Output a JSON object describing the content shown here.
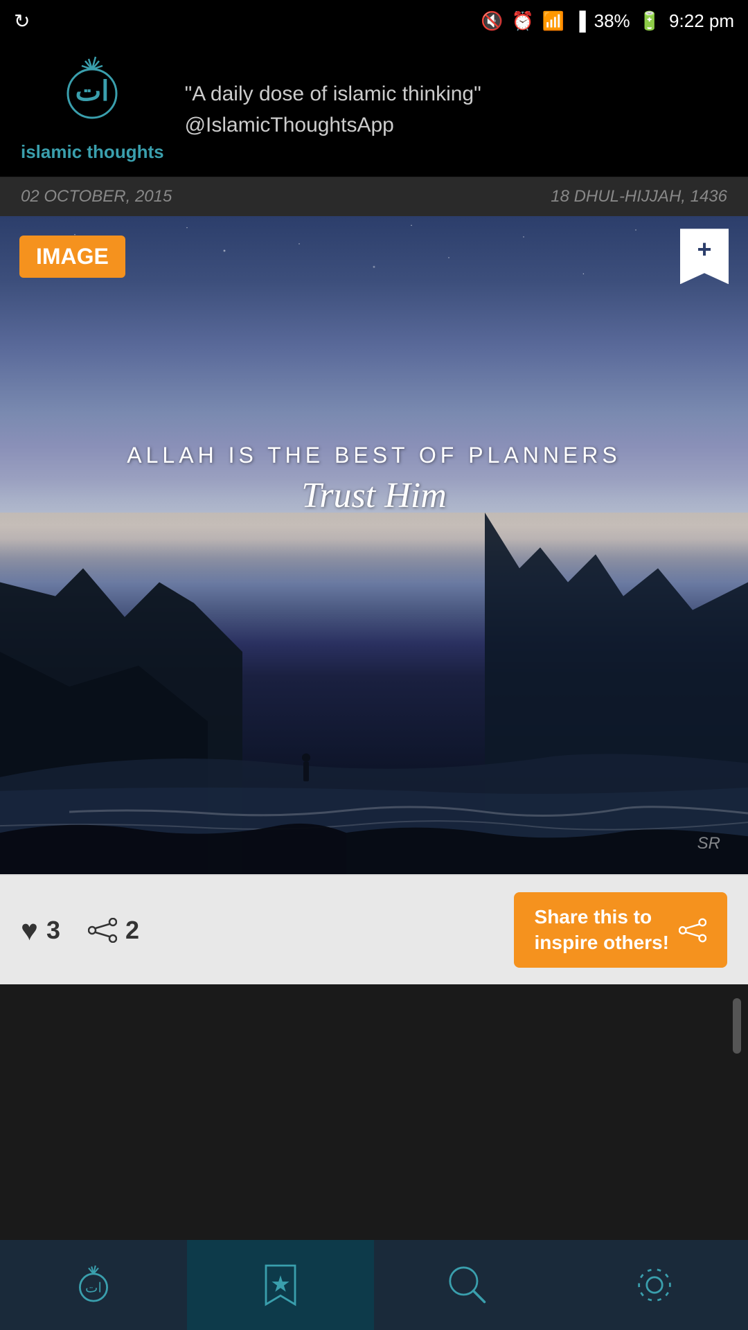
{
  "statusBar": {
    "time": "9:22 pm",
    "battery": "38%",
    "icons": [
      "sync-icon",
      "mute-icon",
      "alarm-icon",
      "wifi-icon",
      "signal-icon",
      "battery-icon"
    ]
  },
  "header": {
    "logoText": "islamic\nthoughts",
    "tagline": "\"A daily dose of islamic thinking\"\n@IslamicThoughtsApp"
  },
  "dateBar": {
    "gregorian": "02 OCTOBER, 2015",
    "hijri": "18 DHUL-HIJJAH, 1436"
  },
  "card": {
    "badge": "IMAGE",
    "quote": {
      "main": "ALLAH IS THE BEST OF PLANNERS",
      "sub": "Trust Him"
    },
    "watermark": "SR",
    "likes": "3",
    "shares": "2",
    "shareButton": "Share this to\ninspire others!"
  },
  "bottomNav": {
    "items": [
      {
        "id": "home",
        "label": "Home",
        "icon": "home-icon"
      },
      {
        "id": "favorites",
        "label": "Favorites",
        "icon": "favorites-icon",
        "active": true
      },
      {
        "id": "search",
        "label": "Search",
        "icon": "search-icon"
      },
      {
        "id": "settings",
        "label": "Settings",
        "icon": "settings-icon"
      }
    ]
  }
}
